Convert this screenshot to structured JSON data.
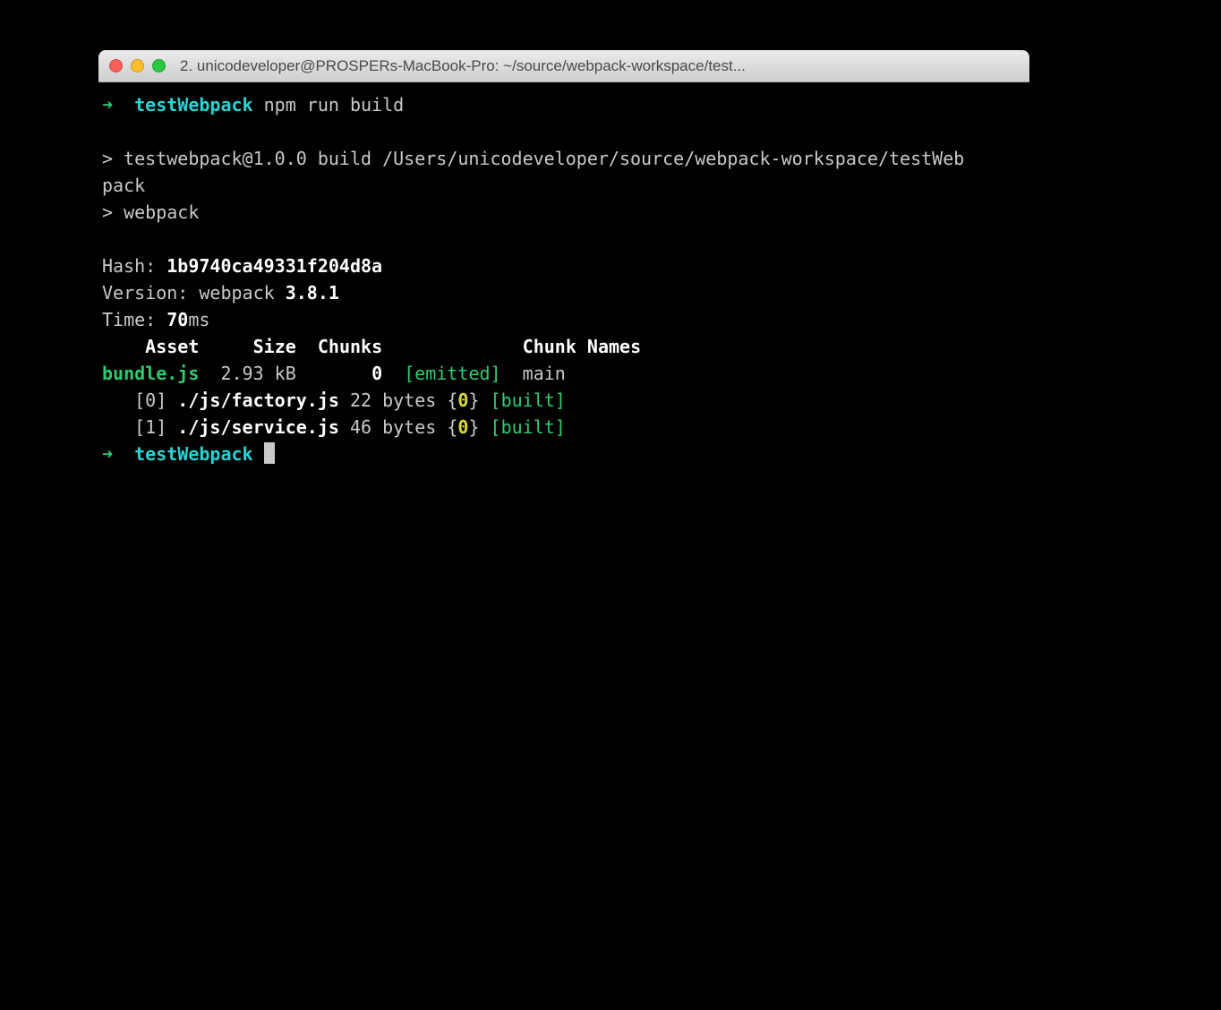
{
  "window": {
    "title": "2. unicodeveloper@PROSPERs-MacBook-Pro: ~/source/webpack-workspace/test..."
  },
  "prompt1": {
    "arrow": "➜",
    "cwd": "testWebpack",
    "cmd": "npm run build"
  },
  "npm": {
    "line1": "> testwebpack@1.0.0 build /Users/unicodeveloper/source/webpack-workspace/testWeb",
    "line1b": "pack",
    "line2": "> webpack"
  },
  "hash": {
    "label": "Hash: ",
    "value": "1b9740ca49331f204d8a"
  },
  "version": {
    "label": "Version: webpack ",
    "value": "3.8.1"
  },
  "time": {
    "label": "Time: ",
    "value": "70",
    "unit": "ms"
  },
  "tableHeader": {
    "asset": "Asset",
    "size": "Size",
    "chunks": "Chunks",
    "chunkNames": "Chunk Names"
  },
  "bundleRow": {
    "asset": "bundle.js",
    "size": "2.93 kB",
    "chunkId": "0",
    "status": "[emitted]",
    "name": "main"
  },
  "modules": [
    {
      "idx": "[0]",
      "path": "./js/factory.js",
      "size": "22 bytes",
      "chunk": "0",
      "status": "[built]"
    },
    {
      "idx": "[1]",
      "path": "./js/service.js",
      "size": "46 bytes",
      "chunk": "0",
      "status": "[built]"
    }
  ],
  "prompt2": {
    "arrow": "➜",
    "cwd": "testWebpack"
  }
}
